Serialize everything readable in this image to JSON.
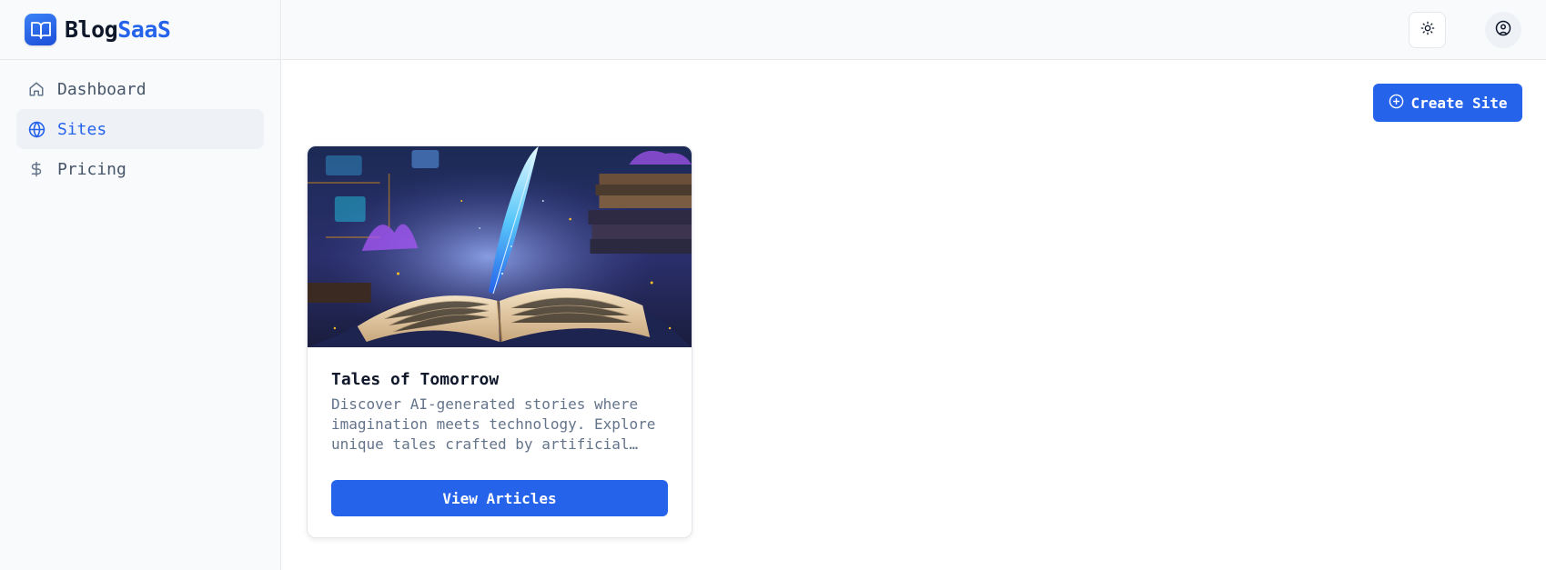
{
  "brand": {
    "name_part1": "Blog",
    "name_part2": "SaaS",
    "icon": "book-open-icon"
  },
  "sidebar": {
    "items": [
      {
        "label": "Dashboard",
        "icon": "home-icon",
        "active": false
      },
      {
        "label": "Sites",
        "icon": "globe-icon",
        "active": true
      },
      {
        "label": "Pricing",
        "icon": "dollar-icon",
        "active": false
      }
    ]
  },
  "header": {
    "theme_icon": "sun-icon",
    "user_icon": "user-circle-icon"
  },
  "main": {
    "create_label": "Create Site",
    "create_icon": "plus-circle-icon",
    "sites": [
      {
        "title": "Tales of Tomorrow",
        "description": "Discover AI-generated stories where imagination meets technology. Explore unique tales crafted by artificial intelligence.",
        "button_label": "View Articles"
      }
    ]
  },
  "colors": {
    "accent": "#2563eb",
    "sidebar_bg": "#f8fafc",
    "active_bg": "#eef2f7",
    "muted_text": "#64748b"
  }
}
